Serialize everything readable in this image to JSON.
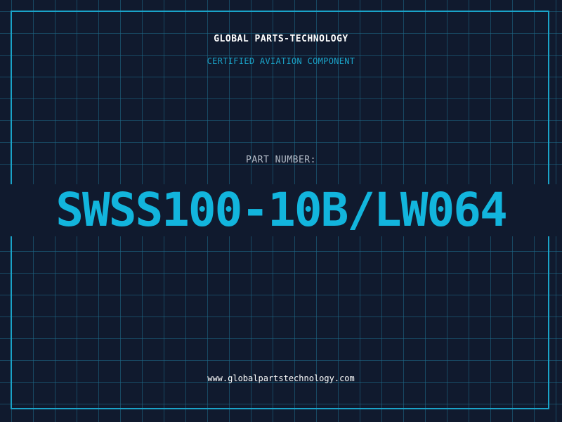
{
  "header": {
    "company": "GLOBAL PARTS-TECHNOLOGY",
    "subtitle": "CERTIFIED AVIATION COMPONENT"
  },
  "part": {
    "label": "PART NUMBER:",
    "number": "SWSS100-10B/LW064"
  },
  "footer": {
    "website": "www.globalpartstechnology.com"
  },
  "colors": {
    "background": "#101a2e",
    "grid": "#1e6e8c",
    "accent": "#12b5dd",
    "text_light": "#ffffff",
    "text_muted": "#b4bcc8"
  }
}
